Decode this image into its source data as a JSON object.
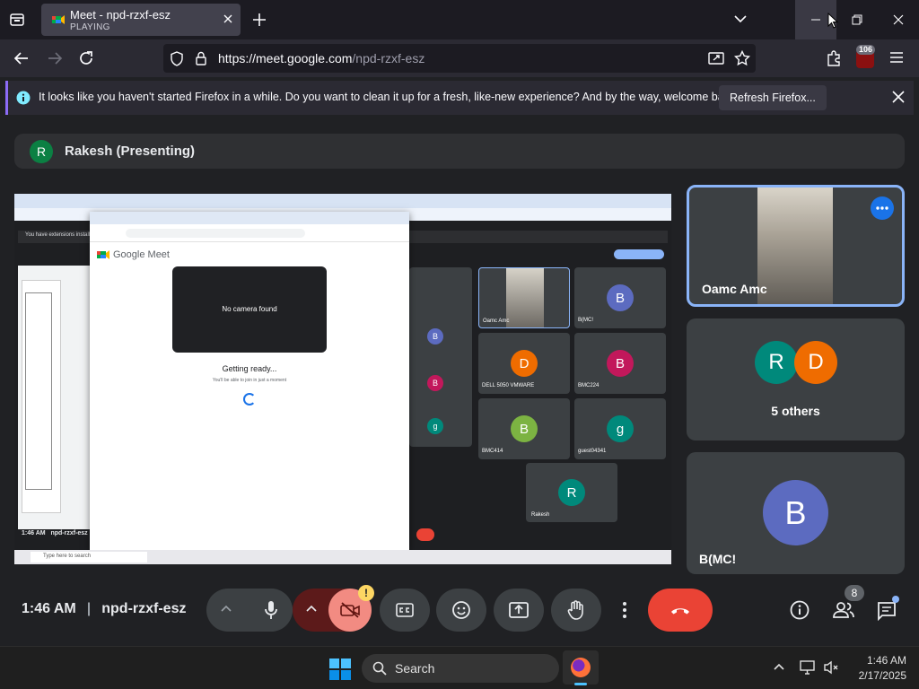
{
  "browser": {
    "tab": {
      "title": "Meet - npd-rzxf-esz",
      "status": "PLAYING"
    },
    "url": {
      "host": "https://meet.google.com",
      "path": "/npd-rzxf-esz"
    },
    "extensions_badge": "106",
    "notification": {
      "message": "It looks like you haven't started Firefox in a while. Do you want to clean it up for a fresh, like-new experience? And by the way, welcome back!",
      "button": "Refresh Firefox..."
    }
  },
  "meet": {
    "presenter": {
      "initial": "R",
      "label": "Rakesh (Presenting)"
    },
    "shared_screen": {
      "inner_window_title": "Google Meet",
      "no_camera": "No camera found",
      "getting_ready": "Getting ready...",
      "sub_note": "You'll be able to join in just a moment",
      "inner_time": "1:46 AM",
      "inner_code": "npd-rzxf-esz",
      "inner_search": "Type here to search",
      "banner": "You have extensions install...",
      "tiles": [
        {
          "initial": "B",
          "name": "B(MC!",
          "color": "#5c6bc0"
        },
        {
          "initial": "D",
          "name": "DELL 5050 VMWARE",
          "color": "#ef6c00"
        },
        {
          "initial": "B",
          "name": "BMC224",
          "color": "#c2185b"
        },
        {
          "initial": "B",
          "name": "BMC414",
          "color": "#7cb342"
        },
        {
          "initial": "g",
          "name": "guest04341",
          "color": "#00897b"
        },
        {
          "initial": "R",
          "name": "Rakesh",
          "color": "#00897b"
        }
      ],
      "self_tile": "Oamc Amc"
    },
    "tiles": {
      "self": {
        "name": "Oamc Amc"
      },
      "others": {
        "label": "5 others",
        "a1": "R",
        "a2": "D",
        "c1": "#00897b",
        "c2": "#ef6c00"
      },
      "bmc": {
        "initial": "B",
        "name": "B(MC!",
        "color": "#5c6bc0"
      }
    },
    "bottom": {
      "time": "1:46 AM",
      "code": "npd-rzxf-esz",
      "people_count": "8"
    }
  },
  "taskbar": {
    "search": "Search",
    "time": "1:46 AM",
    "date": "2/17/2025"
  },
  "colors": {
    "hangup": "#ea4335",
    "accent": "#8ab4f8",
    "cam_off": "#f28b82",
    "warning": "#fdd663"
  }
}
